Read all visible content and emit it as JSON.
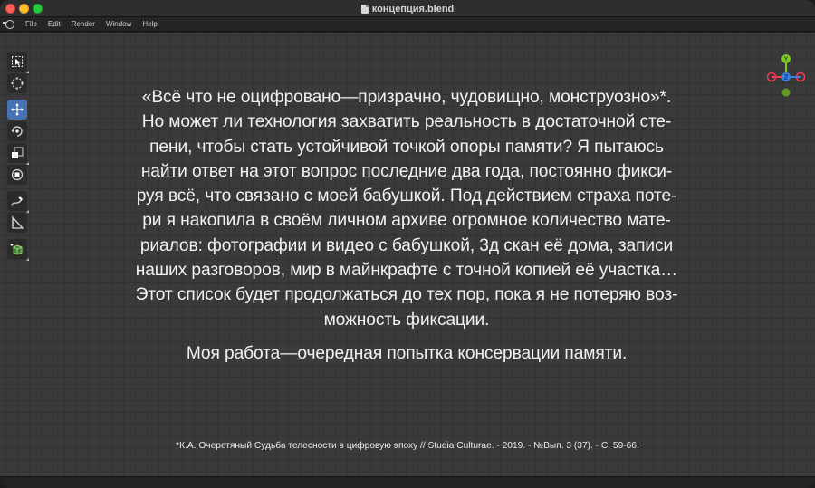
{
  "window": {
    "title": "концепция.blend"
  },
  "menu": {
    "items": [
      "File",
      "Edit",
      "Render",
      "Window",
      "Help"
    ]
  },
  "toolbar": {
    "tools": [
      {
        "name": "select-box-tool",
        "active": false
      },
      {
        "name": "cursor-tool",
        "active": false
      },
      {
        "name": "move-tool",
        "active": true
      },
      {
        "name": "rotate-tool",
        "active": false
      },
      {
        "name": "scale-tool",
        "active": false
      },
      {
        "name": "transform-tool",
        "active": false
      },
      {
        "name": "annotate-tool",
        "active": false
      },
      {
        "name": "measure-tool",
        "active": false
      },
      {
        "name": "add-cube-tool",
        "active": false
      }
    ]
  },
  "gizmo": {
    "x_color": "#f33a54",
    "y_color": "#80c828",
    "z_color": "#2f83e3",
    "labels": {
      "y": "Y",
      "z": "Z"
    }
  },
  "content": {
    "lines": [
      "«Всё что не оцифровано—призрачно, чудовищно, монструозно»*.",
      "Но может ли технология захватить реальность в достаточной сте-",
      "пени, чтобы стать устойчивой точкой опоры памяти? Я пытаюсь",
      "найти ответ на этот вопрос последние два года, постоянно фикси-",
      "руя всё, что связано с моей бабушкой. Под действием страха поте-",
      "ри я накопила в своём личном архиве огромное количество мате-",
      "риалов: фотографии и видео с бабушкой, 3д скан её дома, записи",
      "наших разговоров, мир в майнкрафте с точной копией её участка…",
      "Этот список будет продолжаться до тех пор, пока я не потеряю воз-",
      "можность фиксации."
    ],
    "closing": "Моя работа—очередная попытка консервации памяти.",
    "footnote": "*К.А. Очеретяный Судьба телесности в цифровую эпоху // Studia Culturae. - 2019. - №Вып. 3 (37). - С. 59-66."
  }
}
